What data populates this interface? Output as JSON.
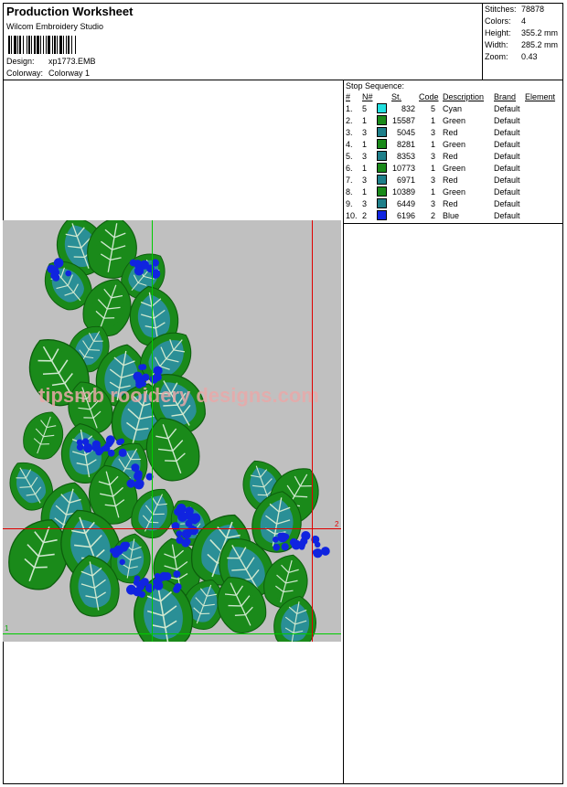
{
  "header": {
    "title": "Production Worksheet",
    "software": "Wilcom Embroidery Studio",
    "design_label": "Design:",
    "design_value": "xp1773.EMB",
    "colorway_label": "Colorway:",
    "colorway_value": "Colorway 1"
  },
  "stats": [
    {
      "label": "Stitches:",
      "value": "78878"
    },
    {
      "label": "Colors:",
      "value": "4"
    },
    {
      "label": "Height:",
      "value": "355.2 mm"
    },
    {
      "label": "Width:",
      "value": "285.2 mm"
    },
    {
      "label": "Zoom:",
      "value": "0.43"
    }
  ],
  "stop_sequence": {
    "title": "Stop Sequence:",
    "columns": [
      "#",
      "N#",
      "St.",
      "Code",
      "Description",
      "Brand",
      "Element"
    ],
    "rows": [
      {
        "idx": "1.",
        "n": "5",
        "color": "#22e0e0",
        "st": "832",
        "code": "5",
        "desc": "Cyan",
        "brand": "Default"
      },
      {
        "idx": "2.",
        "n": "1",
        "color": "#1a8a1a",
        "st": "15587",
        "code": "1",
        "desc": "Green",
        "brand": "Default"
      },
      {
        "idx": "3.",
        "n": "3",
        "color": "#1e7f8a",
        "st": "5045",
        "code": "3",
        "desc": "Red",
        "brand": "Default"
      },
      {
        "idx": "4.",
        "n": "1",
        "color": "#1a8a1a",
        "st": "8281",
        "code": "1",
        "desc": "Green",
        "brand": "Default"
      },
      {
        "idx": "5.",
        "n": "3",
        "color": "#1e7f8a",
        "st": "8353",
        "code": "3",
        "desc": "Red",
        "brand": "Default"
      },
      {
        "idx": "6.",
        "n": "1",
        "color": "#1a8a1a",
        "st": "10773",
        "code": "1",
        "desc": "Green",
        "brand": "Default"
      },
      {
        "idx": "7.",
        "n": "3",
        "color": "#1e7f8a",
        "st": "6971",
        "code": "3",
        "desc": "Red",
        "brand": "Default"
      },
      {
        "idx": "8.",
        "n": "1",
        "color": "#1a8a1a",
        "st": "10389",
        "code": "1",
        "desc": "Green",
        "brand": "Default"
      },
      {
        "idx": "9.",
        "n": "3",
        "color": "#1e7f8a",
        "st": "6449",
        "code": "3",
        "desc": "Red",
        "brand": "Default"
      },
      {
        "idx": "10.",
        "n": "2",
        "color": "#1024e0",
        "st": "6196",
        "code": "2",
        "desc": "Blue",
        "brand": "Default"
      }
    ]
  },
  "preview": {
    "watermark": "tipsmb rooidery designs.com",
    "marker_start": "1",
    "marker_end": "2",
    "colors": {
      "background": "#c0c0c0",
      "leaf": "#1a8a1a",
      "leaf_inner": "#2a8f96",
      "berry": "#1024e0",
      "guide_red": "#e00000",
      "guide_green": "#00cc00"
    }
  }
}
